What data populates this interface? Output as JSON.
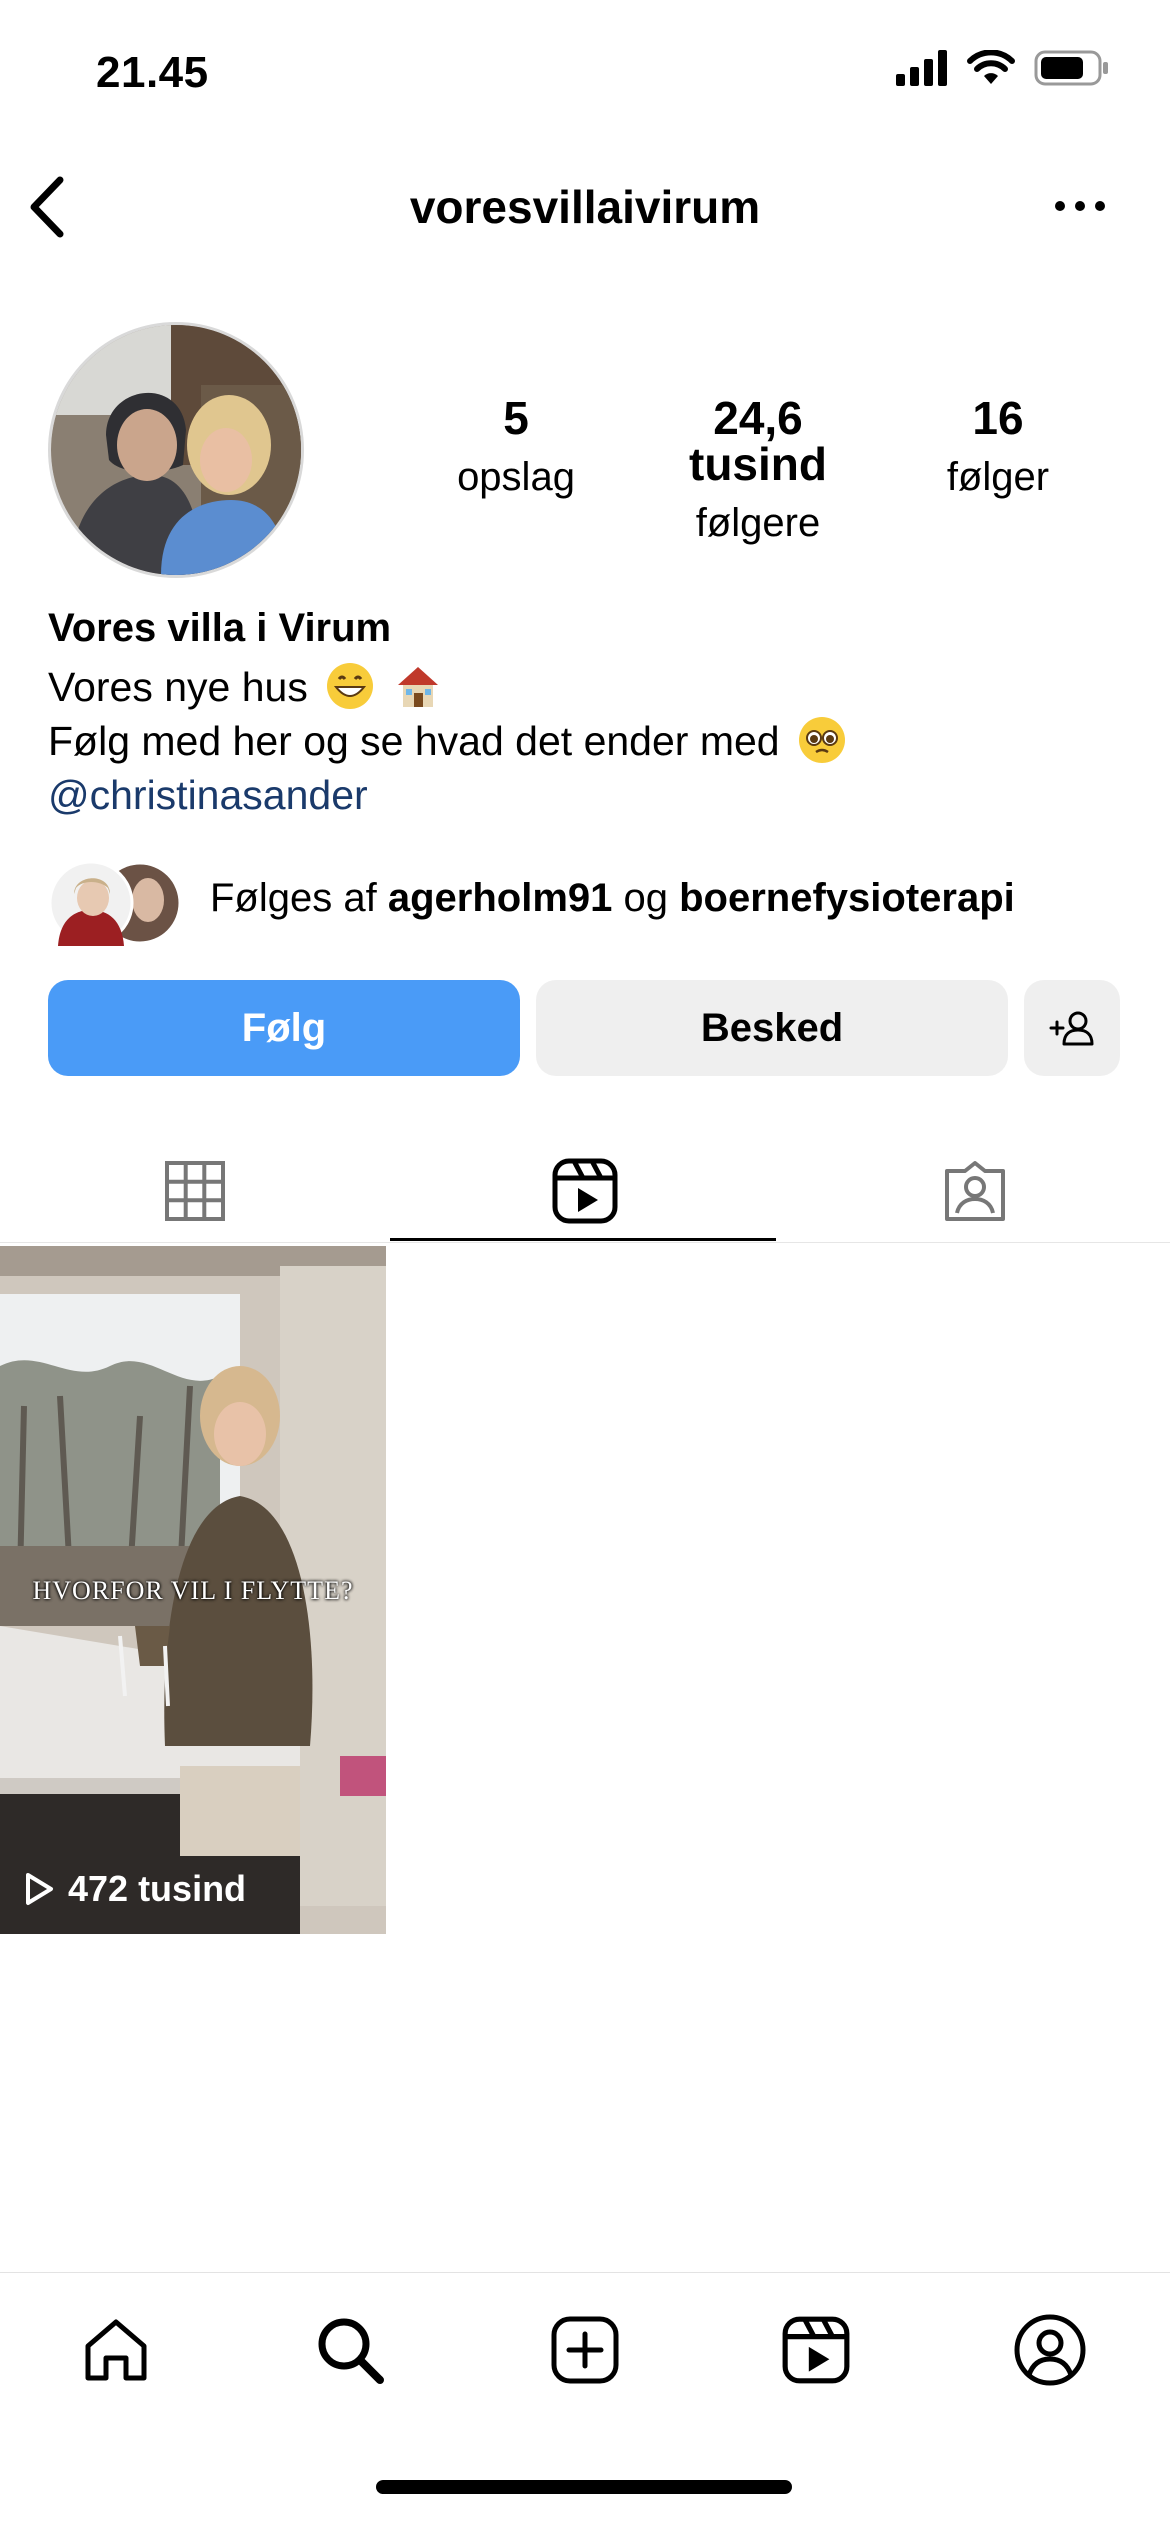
{
  "status_bar": {
    "time": "21.45"
  },
  "header": {
    "username": "voresvillaivirum"
  },
  "profile": {
    "stats": [
      {
        "value": "5",
        "label": "opslag"
      },
      {
        "value": "24,6 tusind",
        "label": "følgere"
      },
      {
        "value": "16",
        "label": "følger"
      }
    ],
    "name": "Vores villa i Virum",
    "bio_line1": "Vores nye hus",
    "bio_line2": "Følg med her og se hvad det ender med",
    "bio_link": "@christinasander"
  },
  "followed_by": {
    "prefix": "Følges af",
    "user1": "agerholm91",
    "conjunction": "og",
    "user2": "boernefysioterapi"
  },
  "actions": {
    "follow_label": "Følg",
    "message_label": "Besked"
  },
  "tabs": {
    "active": "reels"
  },
  "reels": [
    {
      "caption": "HVORFOR VIL I FLYTTE?",
      "views": "472 tusind"
    }
  ],
  "colors": {
    "follow_button": "#4a9bf7",
    "secondary_button": "#efefef",
    "link": "#1a3a6b"
  }
}
